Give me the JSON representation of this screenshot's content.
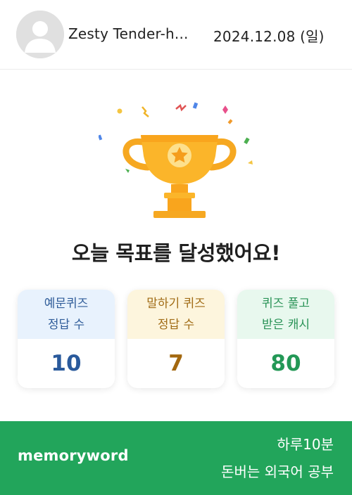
{
  "header": {
    "username": "Zesty Tender-h...",
    "date": "2024.12.08 (일)"
  },
  "headline": "오늘 목표를 달성했어요!",
  "stats": [
    {
      "label_line1": "예문퀴즈",
      "label_line2": "정답 수",
      "value": "10",
      "color": "#2a5a9c"
    },
    {
      "label_line1": "말하기 퀴즈",
      "label_line2": "정답 수",
      "value": "7",
      "color": "#a3680f"
    },
    {
      "label_line1": "퀴즈 풀고",
      "label_line2": "받은 캐시",
      "value": "80",
      "color": "#239856"
    }
  ],
  "footer": {
    "brand": "memoryword",
    "tagline_line1": "하루10분",
    "tagline_line2": "돈버는 외국어 공부",
    "background": "#22a55b"
  },
  "icons": {
    "avatar": "user-avatar-icon",
    "trophy": "trophy-icon",
    "confetti": "confetti-icon"
  }
}
